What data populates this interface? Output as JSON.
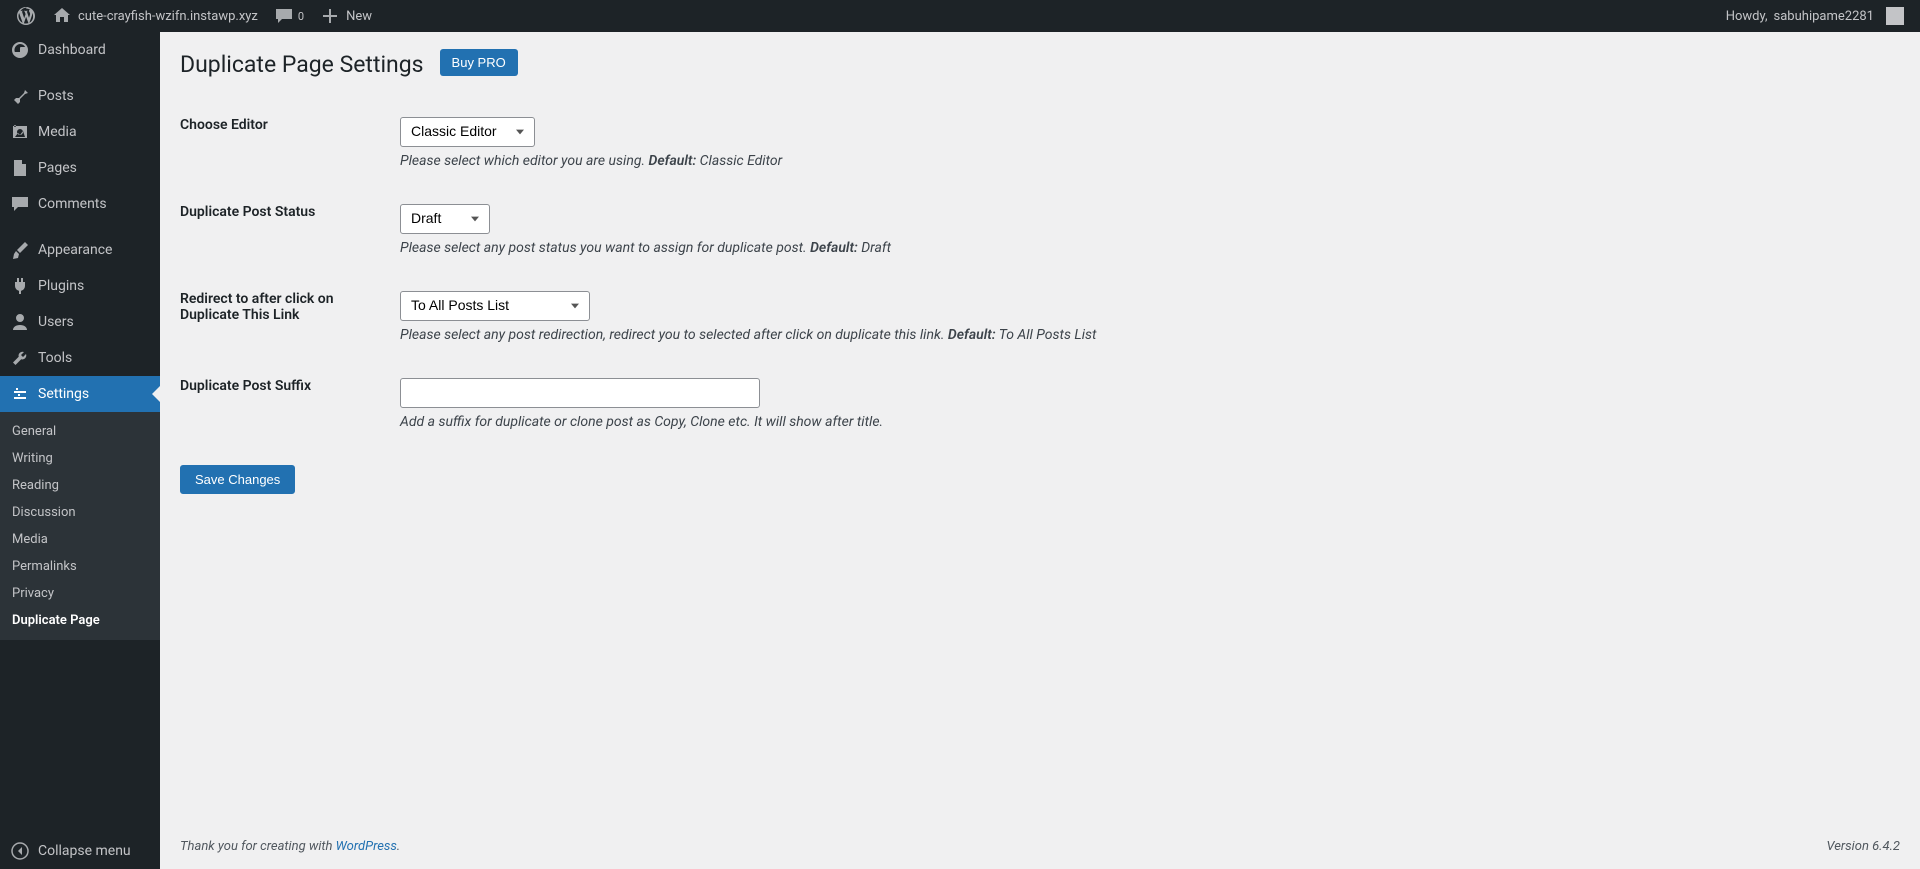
{
  "adminbar": {
    "site_name": "cute-crayfish-wzifn.instawp.xyz",
    "comment_count": "0",
    "new_label": "New",
    "howdy_prefix": "Howdy, ",
    "user": "sabuhipame2281"
  },
  "sidebar": {
    "items": [
      {
        "label": "Dashboard"
      },
      {
        "label": "Posts"
      },
      {
        "label": "Media"
      },
      {
        "label": "Pages"
      },
      {
        "label": "Comments"
      },
      {
        "label": "Appearance"
      },
      {
        "label": "Plugins"
      },
      {
        "label": "Users"
      },
      {
        "label": "Tools"
      },
      {
        "label": "Settings",
        "current": true
      }
    ],
    "submenu": [
      {
        "label": "General"
      },
      {
        "label": "Writing"
      },
      {
        "label": "Reading"
      },
      {
        "label": "Discussion"
      },
      {
        "label": "Media"
      },
      {
        "label": "Permalinks"
      },
      {
        "label": "Privacy"
      },
      {
        "label": "Duplicate Page",
        "current": true
      }
    ],
    "collapse_label": "Collapse menu"
  },
  "page": {
    "title": "Duplicate Page Settings",
    "buy_pro": "Buy PRO",
    "save_changes": "Save Changes"
  },
  "fields": {
    "editor": {
      "label": "Choose Editor",
      "value": "Classic Editor",
      "desc_pre": "Please select which editor you are using. ",
      "desc_strong": "Default:",
      "desc_post": " Classic Editor"
    },
    "status": {
      "label": "Duplicate Post Status",
      "value": "Draft",
      "desc_pre": "Please select any post status you want to assign for duplicate post. ",
      "desc_strong": "Default:",
      "desc_post": " Draft"
    },
    "redirect": {
      "label": "Redirect to after click on Duplicate This Link",
      "value": "To All Posts List",
      "desc_pre": "Please select any post redirection, redirect you to selected after click on duplicate this link. ",
      "desc_strong": "Default:",
      "desc_post": " To All Posts List"
    },
    "suffix": {
      "label": "Duplicate Post Suffix",
      "value": "",
      "desc": "Add a suffix for duplicate or clone post as Copy, Clone etc. It will show after title."
    }
  },
  "footer": {
    "thanks_pre": "Thank you for creating with ",
    "wp": "WordPress",
    "version": "Version 6.4.2"
  }
}
